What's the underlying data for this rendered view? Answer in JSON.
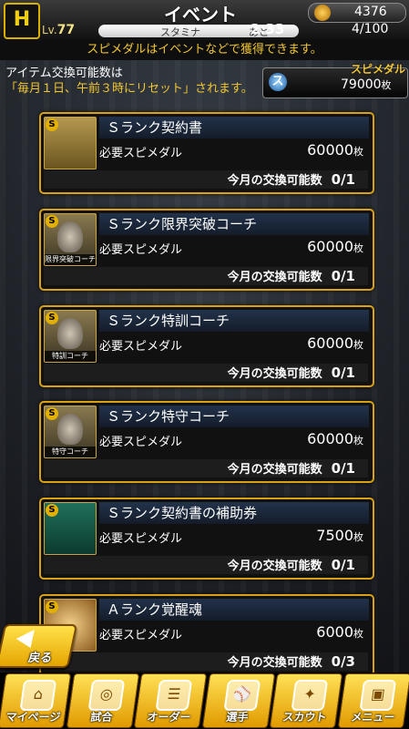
{
  "header": {
    "logo_text": "H",
    "title": "イベント",
    "level_prefix": "Lv.",
    "level": "77",
    "stamina_label": "スタミナ",
    "stamina_ato": "あと",
    "timer": "2:33",
    "stamina_count": "4/100",
    "coins": "4376"
  },
  "banner": "スピメダルはイベントなどで獲得できます。",
  "info": {
    "line1": "アイテム交換可能数は",
    "line2": "「毎月１日、午前３時にリセット」されます。"
  },
  "medal": {
    "title": "スピメダル",
    "icon_text": "ス",
    "value": "79000",
    "unit": "枚"
  },
  "card_labels": {
    "required": "必要スピメダル",
    "exchangeable": "今月の交換可能数",
    "unit": "枚"
  },
  "items": [
    {
      "name": "Ｓランク契約書",
      "price": "60000",
      "exchange": "0/1",
      "icon": "contract-icon",
      "caption": ""
    },
    {
      "name": "Ｓランク限界突破コーチ",
      "price": "60000",
      "exchange": "0/1",
      "icon": "coach-icon",
      "caption": "限界突破コーチ"
    },
    {
      "name": "Ｓランク特訓コーチ",
      "price": "60000",
      "exchange": "0/1",
      "icon": "coach-icon",
      "caption": "特訓コーチ"
    },
    {
      "name": "Ｓランク特守コーチ",
      "price": "60000",
      "exchange": "0/1",
      "icon": "coach-icon",
      "caption": "特守コーチ"
    },
    {
      "name": "Ｓランク契約書の補助券",
      "price": "7500",
      "exchange": "0/1",
      "icon": "ticket-icon",
      "caption": ""
    },
    {
      "name": "Ａランク覚醒魂",
      "price": "6000",
      "exchange": "0/3",
      "icon": "soul-icon",
      "caption": ""
    }
  ],
  "back_button": "戻る",
  "nav": [
    {
      "label": "マイページ",
      "icon": "home-icon",
      "glyph": "⌂"
    },
    {
      "label": "試合",
      "icon": "stadium-icon",
      "glyph": "◎"
    },
    {
      "label": "オーダー",
      "icon": "lineup-icon",
      "glyph": "☰"
    },
    {
      "label": "選手",
      "icon": "player-icon",
      "glyph": "⚾"
    },
    {
      "label": "スカウト",
      "icon": "scout-icon",
      "glyph": "✦"
    },
    {
      "label": "メニュー",
      "icon": "menu-icon",
      "glyph": "▣"
    }
  ]
}
